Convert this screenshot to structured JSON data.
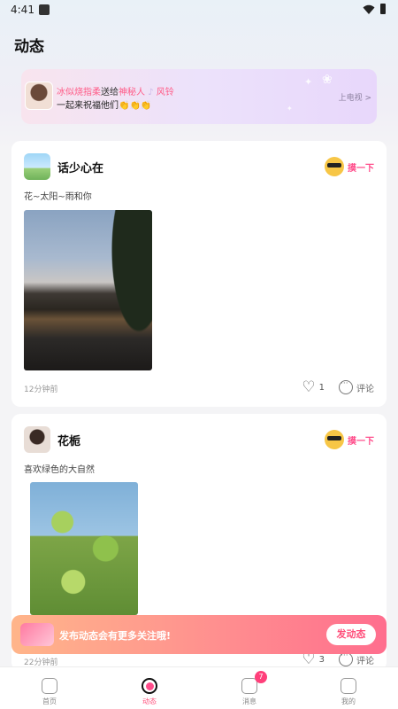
{
  "status": {
    "time": "4:41"
  },
  "page": {
    "title": "动态"
  },
  "banner": {
    "sender": "冰似烧指柔",
    "verb": "送给",
    "receiver": "神秘人",
    "gift": "风铃",
    "line2": "一起来祝福他们👏👏👏",
    "cta": "上电视 >"
  },
  "posts": [
    {
      "username": "话少心在",
      "text": "花~太阳~雨和你",
      "time": "12分钟前",
      "likes": "1",
      "comment_label": "评论",
      "wave_label": "摸一下"
    },
    {
      "username": "花栀",
      "text": "喜欢绿色的大自然",
      "time": "22分钟前",
      "likes": "3",
      "comment_label": "评论",
      "wave_label": "摸一下"
    }
  ],
  "publish": {
    "text": "发布动态会有更多关注哦!",
    "button": "发动态"
  },
  "tabbar": {
    "items": [
      {
        "label": "首页"
      },
      {
        "label": "动态"
      },
      {
        "label": "消息",
        "badge": "7"
      },
      {
        "label": "我的"
      }
    ]
  },
  "colors": {
    "accent": "#ff4d8b",
    "publish_start": "#ffb58a",
    "publish_end": "#ff6e8e"
  }
}
